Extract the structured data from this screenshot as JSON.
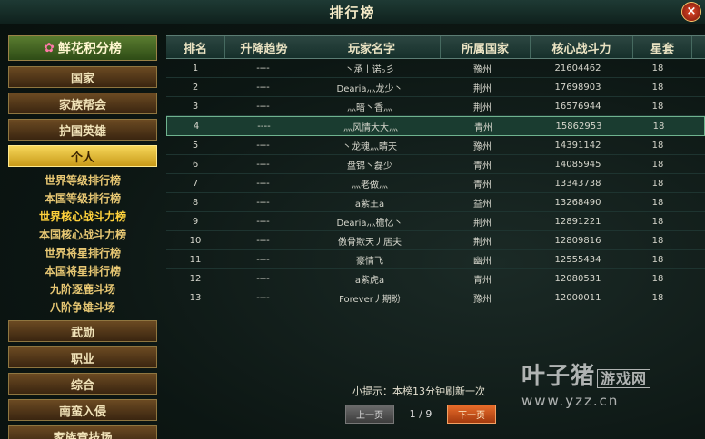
{
  "window": {
    "title": "排行榜",
    "close_label": "×"
  },
  "nav": {
    "top_label": "鲜花积分榜",
    "buttons": [
      "国家",
      "家族帮会",
      "护国英雄",
      "个人"
    ],
    "active": "个人",
    "sub_items": [
      "世界等级排行榜",
      "本国等级排行榜",
      "世界核心战斗力榜",
      "本国核心战斗力榜",
      "世界将星排行榜",
      "本国将星排行榜",
      "九阶逐鹿斗场",
      "八阶争雄斗场"
    ],
    "selected_sub": "世界核心战斗力榜",
    "bottom_buttons": [
      "武勋",
      "职业",
      "综合",
      "南蛮入侵",
      "家族竞技场"
    ]
  },
  "table": {
    "headers": [
      "排名",
      "升降趋势",
      "玩家名字",
      "所属国家",
      "核心战斗力",
      "星套"
    ],
    "rows": [
      [
        "1",
        "----",
        "丶承丨诺ℴ彡",
        "豫州",
        "21604462",
        "18"
      ],
      [
        "2",
        "----",
        "Dearia灬龙少丶",
        "荆州",
        "17698903",
        "18"
      ],
      [
        "3",
        "----",
        "灬暗丶香灬",
        "荆州",
        "16576944",
        "18"
      ],
      [
        "4",
        "----",
        "灬风情大大灬",
        "青州",
        "15862953",
        "18"
      ],
      [
        "5",
        "----",
        "丶龙魂灬晴天",
        "豫州",
        "14391142",
        "18"
      ],
      [
        "6",
        "----",
        "盘锦丶磊少",
        "青州",
        "14085945",
        "18"
      ],
      [
        "7",
        "----",
        "灬老做灬",
        "青州",
        "13343738",
        "18"
      ],
      [
        "8",
        "----",
        "a紫王a",
        "益州",
        "13268490",
        "18"
      ],
      [
        "9",
        "----",
        "Dearia灬檐忆丶",
        "荆州",
        "12891221",
        "18"
      ],
      [
        "10",
        "----",
        "傲骨欺天丿居夫",
        "荆州",
        "12809816",
        "18"
      ],
      [
        "11",
        "----",
        "豪情飞",
        "幽州",
        "12555434",
        "18"
      ],
      [
        "12",
        "----",
        "a紫虎a",
        "青州",
        "12080531",
        "18"
      ],
      [
        "13",
        "----",
        "Forever丿期盼",
        "豫州",
        "12000011",
        "18"
      ]
    ],
    "highlight_row_index": 3
  },
  "footer": {
    "tip": "小提示：本榜13分钟刷新一次",
    "prev_label": "上一页",
    "page": "1 / 9",
    "next_label": "下一页"
  },
  "watermark": {
    "line1": "叶子猪",
    "line1_box": "游戏网",
    "line2": "www.yzz.cn"
  },
  "colors": {
    "accent_gold": "#ffd23c",
    "highlight_row": "#1a3c30",
    "next_button": "#e86c2a"
  }
}
